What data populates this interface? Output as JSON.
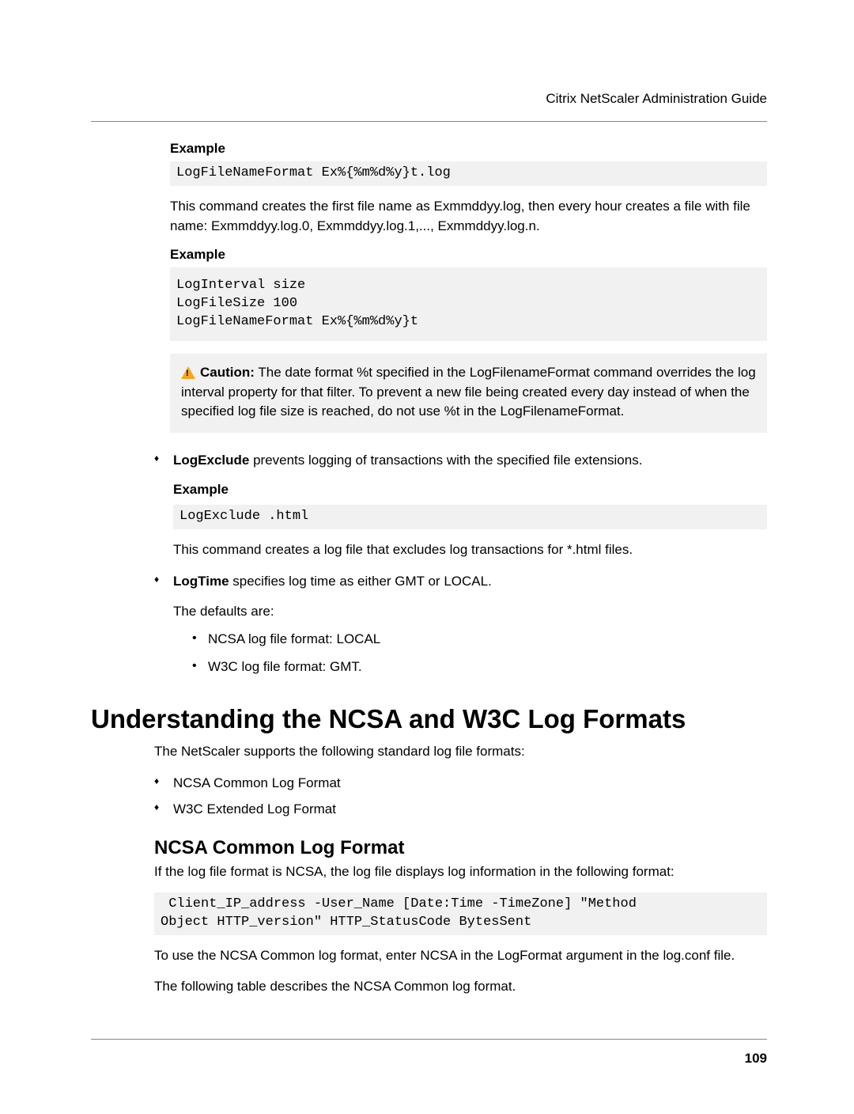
{
  "header": {
    "title": "Citrix NetScaler Administration Guide"
  },
  "section1": {
    "example1_label": "Example",
    "example1_code": "LogFileNameFormat Ex%{%m%d%y}t.log",
    "para1": "This command creates the first file name as Exmmddyy.log, then every hour creates a file with file name: Exmmddyy.log.0, Exmmddyy.log.1,..., Exmmddyy.log.n.",
    "example2_label": "Example",
    "example2_code": "LogInterval size\nLogFileSize 100\nLogFileNameFormat Ex%{%m%d%y}t",
    "caution_label": "Caution:",
    "caution_text": "  The date format %t specified in the LogFilenameFormat command overrides the log interval property for that filter. To prevent a new file being created every day instead of when the specified log file size is reached, do not use %t in the LogFilenameFormat."
  },
  "bullets": {
    "logExclude_term": "LogExclude",
    "logExclude_desc": " prevents logging of transactions with the specified file extensions.",
    "example3_label": "Example",
    "example3_code": "LogExclude .html",
    "para2": "This command creates a log file that excludes log transactions for *.html files.",
    "logTime_term": "LogTime",
    "logTime_desc": " specifies log time as either GMT or LOCAL.",
    "defaults_intro": "The defaults are:",
    "default1": "NCSA log file format: LOCAL",
    "default2": "W3C log file format: GMT."
  },
  "heading1": "Understanding the NCSA and W3C Log Formats",
  "para3": "The NetScaler supports the following standard log file formats:",
  "formats": {
    "item1": "NCSA Common Log Format",
    "item2": "W3C Extended Log Format"
  },
  "heading2": "NCSA Common Log Format",
  "para4": "If the log file format is NCSA, the log file displays log information in the following format:",
  "code4": " Client_IP_address -User_Name [Date:Time -TimeZone] \"Method\nObject HTTP_version\" HTTP_StatusCode BytesSent",
  "para5": "To use the NCSA Common log format, enter NCSA in the LogFormat argument in the log.conf file.",
  "para6": "The following table describes the NCSA Common log format.",
  "pageNumber": "109"
}
